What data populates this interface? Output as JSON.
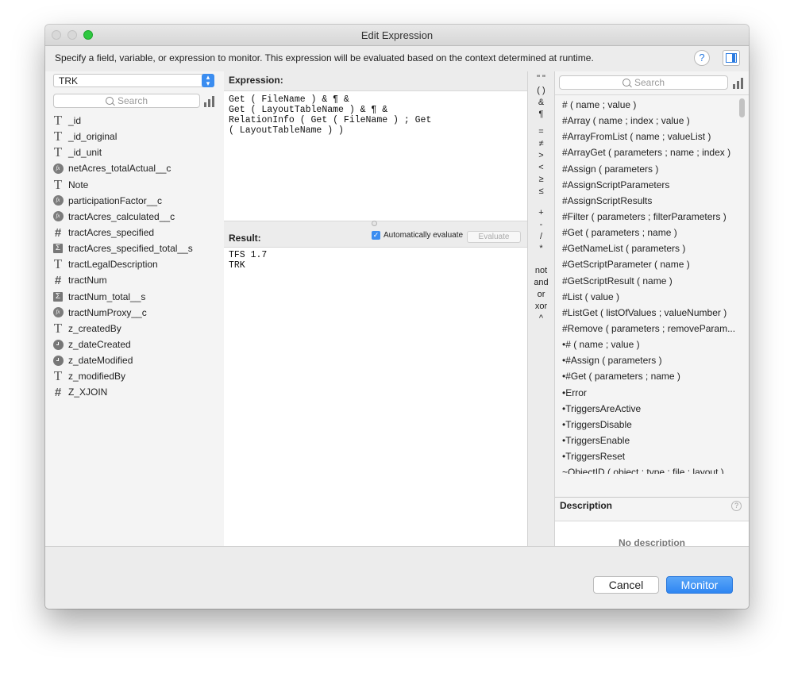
{
  "window": {
    "title": "Edit Expression",
    "instructions": "Specify a field, variable, or expression to monitor. This expression will be evaluated based on the context determined at runtime.",
    "help_glyph": "?"
  },
  "left": {
    "table": "TRK",
    "search_placeholder": "Search",
    "fields": [
      {
        "icon": "text",
        "name": "_id"
      },
      {
        "icon": "text",
        "name": "_id_original"
      },
      {
        "icon": "text",
        "name": "_id_unit"
      },
      {
        "icon": "calc",
        "name": "netAcres_totalActual__c"
      },
      {
        "icon": "text",
        "name": "Note"
      },
      {
        "icon": "calc",
        "name": "participationFactor__c"
      },
      {
        "icon": "calc",
        "name": "tractAcres_calculated__c"
      },
      {
        "icon": "number",
        "name": "tractAcres_specified"
      },
      {
        "icon": "summary",
        "name": "tractAcres_specified_total__s"
      },
      {
        "icon": "text",
        "name": "tractLegalDescription"
      },
      {
        "icon": "number",
        "name": "tractNum"
      },
      {
        "icon": "summary",
        "name": "tractNum_total__s"
      },
      {
        "icon": "calc",
        "name": "tractNumProxy__c"
      },
      {
        "icon": "text",
        "name": "z_createdBy"
      },
      {
        "icon": "timestamp",
        "name": "z_dateCreated"
      },
      {
        "icon": "timestamp",
        "name": "z_dateModified"
      },
      {
        "icon": "text",
        "name": "z_modifiedBy"
      },
      {
        "icon": "number",
        "name": "Z_XJOIN"
      }
    ]
  },
  "expression": {
    "label": "Expression:",
    "text": "Get ( FileName ) & ¶ &\nGet ( LayoutTableName ) & ¶ &\nRelationInfo ( Get ( FileName ) ; Get\n( LayoutTableName ) )"
  },
  "result": {
    "label": "Result:",
    "auto_evaluate_label": "Automatically evaluate",
    "auto_evaluate_checked": true,
    "evaluate_button": "Evaluate",
    "text": "TFS 1.7\nTRK"
  },
  "operators": [
    "\" \"",
    "( )",
    "&",
    "¶",
    "=",
    "≠",
    ">",
    "<",
    "≥",
    "≤",
    "+",
    "-",
    "/",
    "*",
    "not",
    "and",
    "or",
    "xor",
    "^"
  ],
  "functions": {
    "search_placeholder": "Search",
    "items": [
      "# ( name ; value )",
      "#Array ( name ; index ; value )",
      "#ArrayFromList ( name ; valueList )",
      "#ArrayGet ( parameters ; name ; index )",
      "#Assign ( parameters )",
      "#AssignScriptParameters",
      "#AssignScriptResults",
      "#Filter ( parameters ; filterParameters )",
      "#Get ( parameters ; name )",
      "#GetNameList ( parameters )",
      "#GetScriptParameter ( name )",
      "#GetScriptResult ( name )",
      "#List ( value )",
      "#ListGet ( listOfValues ; valueNumber )",
      "#Remove ( parameters ; removeParam...",
      "•# ( name ; value )",
      "•#Assign ( parameters )",
      "•#Get ( parameters ; name )",
      "•Error",
      "•TriggersAreActive",
      "•TriggersDisable",
      "•TriggersEnable",
      "•TriggersReset",
      "~ObjectID ( object ; type ; file ; layout )"
    ]
  },
  "description": {
    "label": "Description",
    "help_glyph": "?",
    "empty_text": "No description"
  },
  "buttons": {
    "cancel": "Cancel",
    "monitor": "Monitor"
  },
  "colors": {
    "accent": "#3b8df0",
    "zoom_button": "#2ec840"
  }
}
